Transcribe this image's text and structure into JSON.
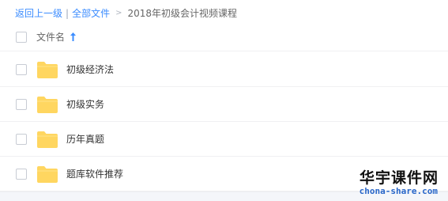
{
  "breadcrumb": {
    "back": "返回上一级",
    "separator": "|",
    "all_files": "全部文件",
    "arrow": ">",
    "current": "2018年初级会计视频课程"
  },
  "list_header": {
    "name_label": "文件名",
    "sort_icon": "arrow-up-icon"
  },
  "files": [
    {
      "name": "初级经济法",
      "icon": "folder-icon"
    },
    {
      "name": "初级实务",
      "icon": "folder-icon"
    },
    {
      "name": "历年真题",
      "icon": "folder-icon"
    },
    {
      "name": "题库软件推荐",
      "icon": "folder-icon"
    }
  ],
  "watermark": {
    "title": "华宇课件网",
    "url": "chona-share.com"
  },
  "colors": {
    "link": "#3b8cff",
    "folder": "#ffd660",
    "watermark_url": "#2866c9"
  }
}
